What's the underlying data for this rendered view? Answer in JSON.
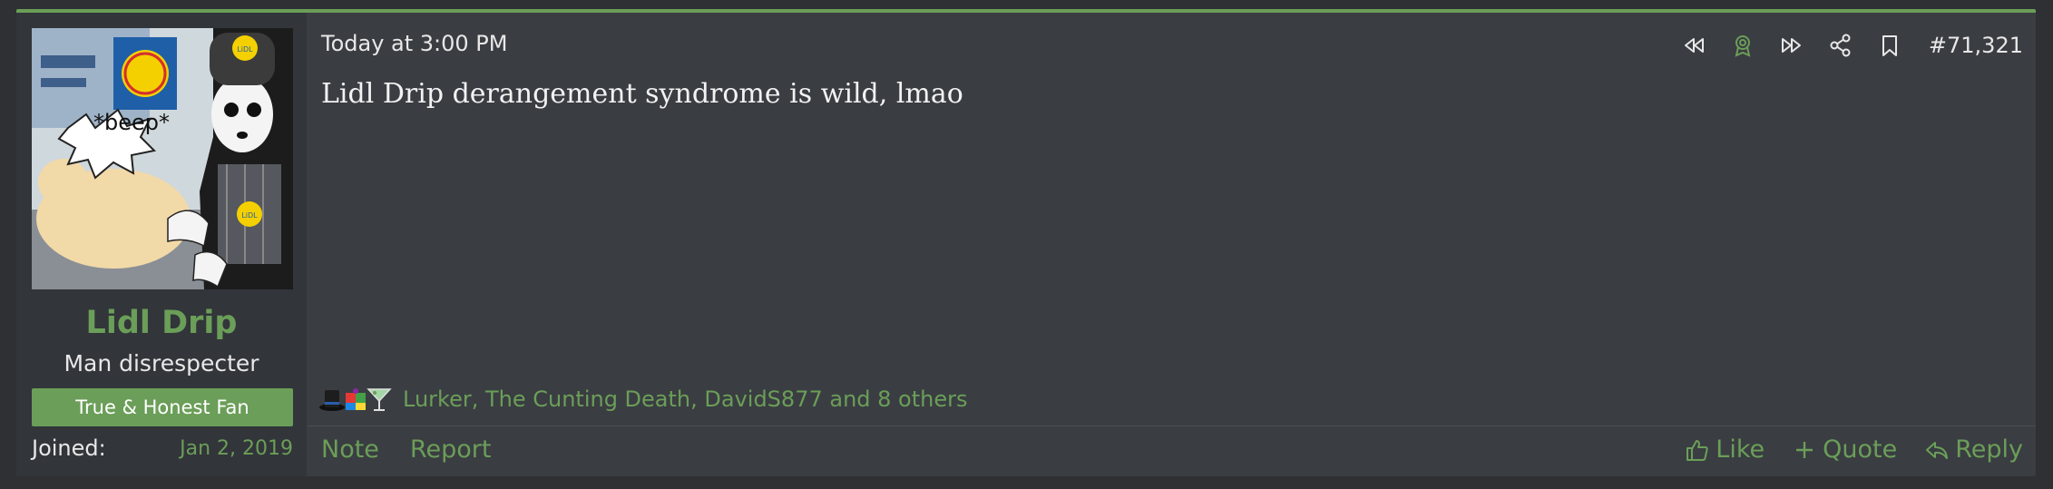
{
  "colors": {
    "accent": "#6b9e58",
    "post_bg": "#3a3d42",
    "sidebar_bg": "#32353a",
    "text": "#e8e8e8"
  },
  "user": {
    "name": "Lidl Drip",
    "title": "Man disrespecter",
    "banner": "True & Honest Fan",
    "joined_label": "Joined:",
    "joined_value": "Jan 2, 2019",
    "avatar_text": "*beep*",
    "avatar_badge_text": "LiDL"
  },
  "post": {
    "timestamp": "Today at 3:00 PM",
    "number": "#71,321",
    "message": "Lidl Drip derangement syndrome is wild, lmao",
    "top_icons": [
      "rewind-icon",
      "award-icon",
      "fast-forward-icon",
      "share-icon",
      "bookmark-icon"
    ]
  },
  "reactions": {
    "icons": [
      "top-hat-icon",
      "puzzle-icon",
      "cocktail-icon"
    ],
    "text": "Lurker, The Cunting Death, DavidS877 and 8 others"
  },
  "footer": {
    "note": "Note",
    "report": "Report",
    "like": "Like",
    "quote": "Quote",
    "reply": "Reply"
  }
}
